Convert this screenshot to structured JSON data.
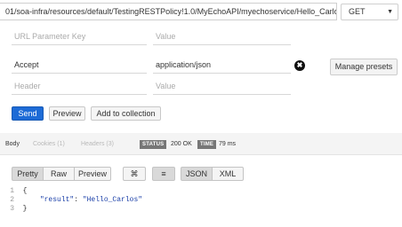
{
  "request": {
    "url": "01/soa-infra/resources/default/TestingRESTPolicy!1.0/MyEchoAPI/myechoservice/Hello_Carlos",
    "method": "GET",
    "method_caret": "▼"
  },
  "params": {
    "key_placeholder": "URL Parameter Key",
    "value_placeholder": "Value"
  },
  "headers": {
    "rows": [
      {
        "key": "Accept",
        "value": "application/json"
      }
    ],
    "new_key_placeholder": "Header",
    "new_value_placeholder": "Value",
    "remove_icon": "✖",
    "manage_label": "Manage presets"
  },
  "actions": {
    "send": "Send",
    "preview": "Preview",
    "add_to_collection": "Add to collection"
  },
  "response_tabs": {
    "body": "Body",
    "cookies": "Cookies (1)",
    "headers": "Headers (3)"
  },
  "response_status": {
    "status_label": "STATUS",
    "status_value": "200 OK",
    "time_label": "TIME",
    "time_value": "79 ms"
  },
  "view_modes": {
    "pretty": "Pretty",
    "raw": "Raw",
    "preview": "Preview",
    "expand_icon": "⌘",
    "wrap_icon": "≡",
    "json": "JSON",
    "xml": "XML"
  },
  "response_body": {
    "line_numbers": [
      "1",
      "2",
      "3"
    ],
    "open_brace": "{",
    "key": "\"result\"",
    "colon": ": ",
    "value": "\"Hello_Carlos\"",
    "close_brace": "}"
  }
}
